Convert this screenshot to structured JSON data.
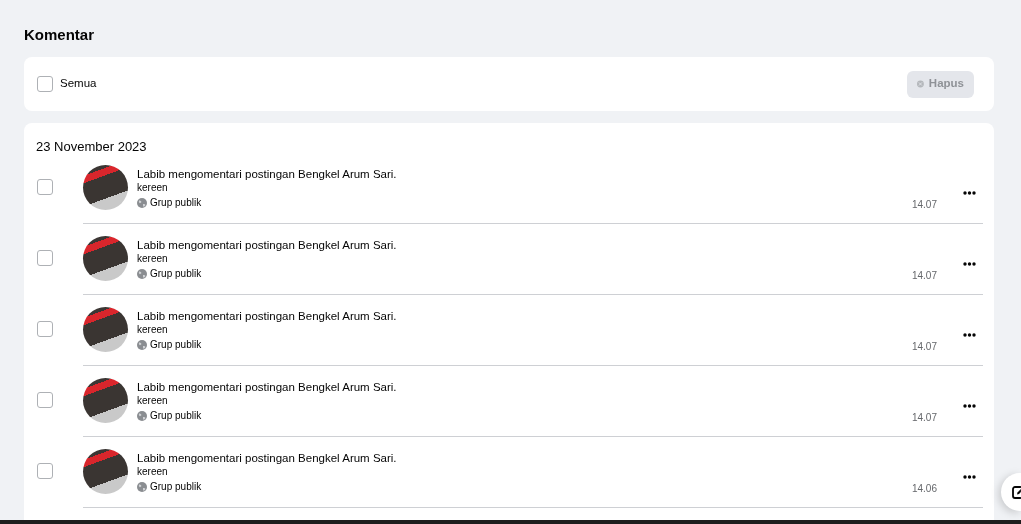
{
  "page": {
    "title": "Komentar"
  },
  "toolbar": {
    "select_all": {
      "label": "Semua",
      "checked": false
    },
    "delete_button": {
      "label": "Hapus",
      "disabled": true
    }
  },
  "groups": [
    {
      "date": "23 November 2023",
      "items": [
        {
          "title": "Labib mengomentari postingan Bengkel Arum Sari.",
          "comment": "kereen",
          "audience": "Grup publik",
          "time": "14.07",
          "checked": false
        },
        {
          "title": "Labib mengomentari postingan Bengkel Arum Sari.",
          "comment": "kereen",
          "audience": "Grup publik",
          "time": "14.07",
          "checked": false
        },
        {
          "title": "Labib mengomentari postingan Bengkel Arum Sari.",
          "comment": "kereen",
          "audience": "Grup publik",
          "time": "14.07",
          "checked": false
        },
        {
          "title": "Labib mengomentari postingan Bengkel Arum Sari.",
          "comment": "kereen",
          "audience": "Grup publik",
          "time": "14.07",
          "checked": false
        },
        {
          "title": "Labib mengomentari postingan Bengkel Arum Sari.",
          "comment": "kereen",
          "audience": "Grup publik",
          "time": "14.06",
          "checked": false
        }
      ]
    }
  ]
}
